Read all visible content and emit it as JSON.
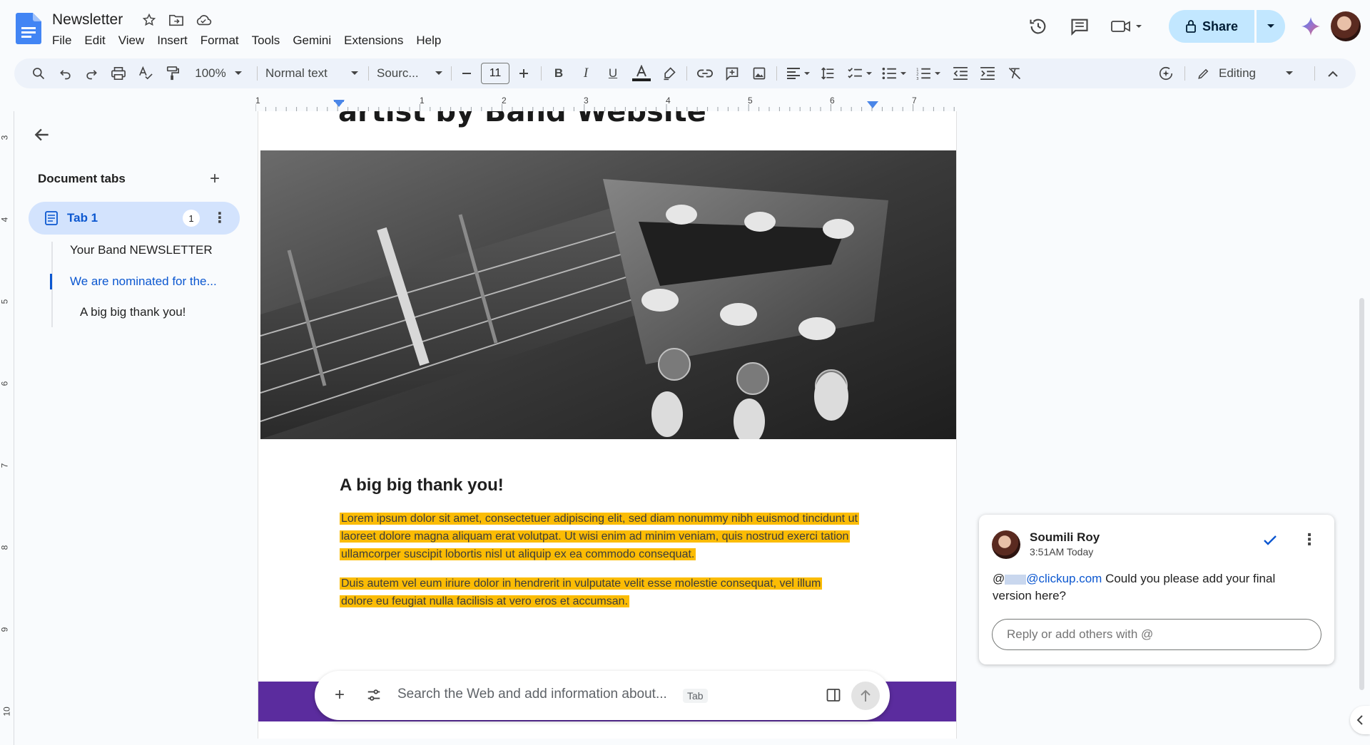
{
  "app": {
    "title": "Newsletter",
    "menu": [
      "File",
      "Edit",
      "View",
      "Insert",
      "Format",
      "Tools",
      "Gemini",
      "Extensions",
      "Help"
    ],
    "share_label": "Share"
  },
  "toolbar": {
    "zoom": "100%",
    "style": "Normal text",
    "font": "Sourc...",
    "font_size": "11",
    "mode": "Editing"
  },
  "ruler": {
    "h_numbers": [
      "1",
      "1",
      "2",
      "3",
      "4",
      "5",
      "6",
      "7"
    ],
    "v_numbers": [
      "3",
      "4",
      "5",
      "6",
      "7",
      "8",
      "9",
      "10"
    ]
  },
  "sidebar": {
    "title": "Document tabs",
    "tab_label": "Tab 1",
    "tab_count": "1",
    "outline": [
      {
        "label": "Your Band NEWSLETTER"
      },
      {
        "label": "We are nominated for the..."
      },
      {
        "label": "A big big thank you!"
      }
    ]
  },
  "document": {
    "cut_heading": "artist by Band Website",
    "heading": "A big big thank you!",
    "para1": "Lorem ipsum dolor sit amet, consectetuer adipiscing elit, sed diam nonummy nibh euismod tincidunt ut laoreet dolore magna aliquam erat volutpat. Ut wisi enim ad minim veniam, quis nostrud exerci tation ullamcorper suscipit lobortis nisl ut aliquip ex ea commodo consequat.",
    "para2": "Duis autem vel eum iriure dolor in hendrerit in vulputate velit esse molestie consequat, vel illum dolore eu feugiat nulla facilisis at vero eros et accumsan."
  },
  "ask_bar": {
    "placeholder": "Search the Web and add information about...",
    "hint": "Tab"
  },
  "comment": {
    "author": "Soumili Roy",
    "time": "3:51AM Today",
    "mention": "@clickup.com",
    "text": "Could you please add your final version here?",
    "reply_placeholder": "Reply or add others with @"
  },
  "colors": {
    "accent": "#0b57d0",
    "share_bg": "#c2e7ff",
    "highlight": "#fbbc04",
    "banner": "#5b2c9e"
  }
}
